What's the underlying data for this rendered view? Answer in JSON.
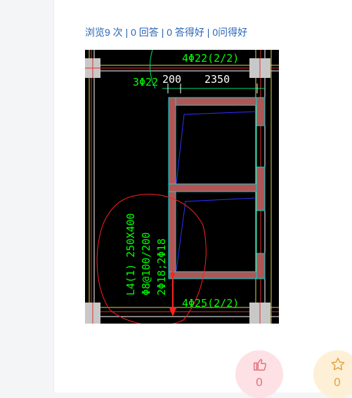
{
  "stats": {
    "views": "浏览9 次",
    "answers": "0 回答",
    "good_answers": "0 答得好",
    "good_questions": "0问得好",
    "separator": "|"
  },
  "drawing": {
    "labels": {
      "top_rebar": "4Φ22(2/2)",
      "left_rebar": "3Φ22",
      "dim_a": "200",
      "dim_b": "2350",
      "beam_line1": "L4(1) 250X400",
      "beam_line2": "Φ8@100/200",
      "beam_line3": "2Φ18;2Φ18",
      "bottom_rebar": "4Φ25(2/2)"
    },
    "colors": {
      "background": "#000000",
      "wall": "#c05a5a",
      "dimension": "#00ff00",
      "outline": "#00e5e5",
      "annotation": "#ff2020",
      "diagonal": "#2020ff"
    }
  },
  "votes": {
    "like_count": "0",
    "favorite_count": "0",
    "like_icon": "thumbs-up-icon",
    "favorite_icon": "star-icon"
  }
}
